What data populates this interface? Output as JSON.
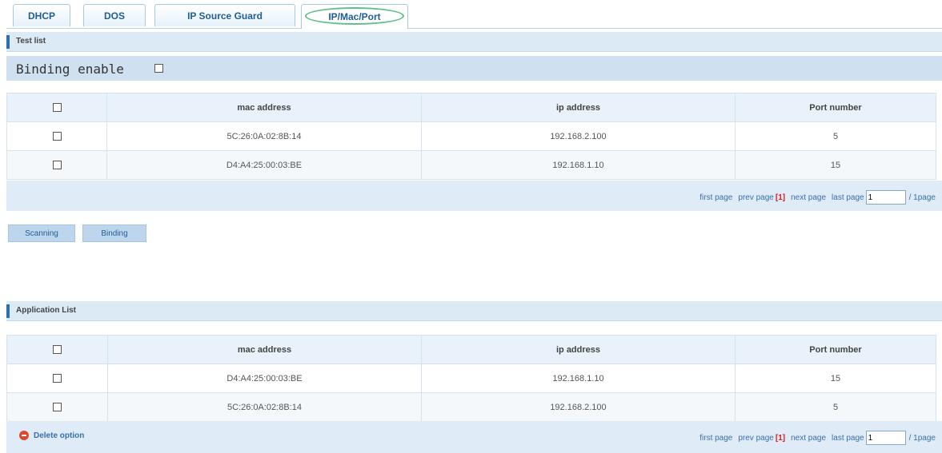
{
  "tabs": [
    {
      "label": "DHCP"
    },
    {
      "label": "DOS"
    },
    {
      "label": "IP Source Guard"
    },
    {
      "label": "IP/Mac/Port",
      "active": true
    }
  ],
  "test_list": {
    "title": "Test list",
    "binding_enable_label": "Binding enable",
    "columns": [
      "mac address",
      "ip address",
      "Port number"
    ],
    "rows": [
      {
        "mac": "5C:26:0A:02:8B:14",
        "ip": "192.168.2.100",
        "port": "5"
      },
      {
        "mac": "D4:A4:25:00:03:BE",
        "ip": "192.168.1.10",
        "port": "15"
      }
    ],
    "pager": {
      "first": "first page",
      "prev": "prev page",
      "current": "[1]",
      "next": "next page",
      "last": "last page",
      "page_value": "1",
      "total": "/ 1page"
    }
  },
  "buttons": {
    "scanning": "Scanning",
    "binding": "Binding"
  },
  "application_list": {
    "title": "Application List",
    "columns": [
      "mac address",
      "ip address",
      "Port number"
    ],
    "rows": [
      {
        "mac": "D4:A4:25:00:03:BE",
        "ip": "192.168.1.10",
        "port": "15"
      },
      {
        "mac": "5C:26:0A:02:8B:14",
        "ip": "192.168.2.100",
        "port": "5"
      }
    ],
    "delete_label": "Delete option",
    "pager": {
      "first": "first page",
      "prev": "prev page",
      "current": "[1]",
      "next": "next page",
      "last": "last page",
      "page_value": "1",
      "total": "/ 1page"
    }
  },
  "colors": {
    "accent": "#2a6fb0",
    "active_tab_highlight": "#5fbf8a",
    "current_page": "#d81e1e",
    "delete_icon": "#e0482e"
  },
  "icons": {
    "delete": "minus-circle-icon"
  }
}
